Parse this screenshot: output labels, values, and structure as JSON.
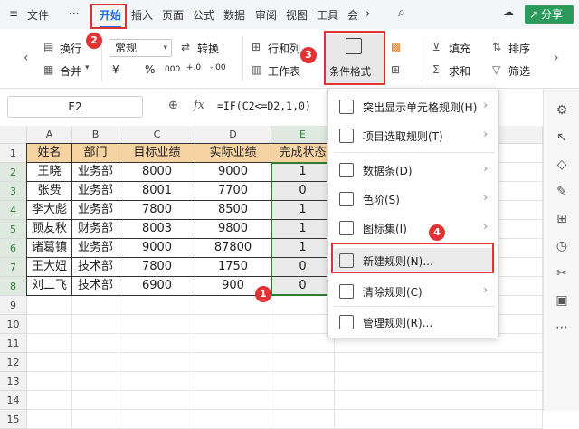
{
  "topbar": {
    "menu_icon": "≡",
    "file_label": "文件",
    "more_label": "···",
    "tabs": [
      "开始",
      "插入",
      "页面",
      "公式",
      "数据",
      "审阅",
      "视图",
      "工具",
      "会"
    ],
    "active_tab": "开始",
    "share_label": "分享"
  },
  "ribbon": {
    "wrap_label": "换行",
    "merge_label": "合并",
    "number_format": "常规",
    "convert_label": "转换",
    "currency_symbol": "¥",
    "percent_symbol": "%",
    "thousands_symbol": "000",
    "inc_decimal": "+.0",
    "dec_decimal": "-.00",
    "rowcol_label": "行和列",
    "sheet_label": "工作表",
    "cond_format_label": "条件格式",
    "fill_label": "填充",
    "sort_label": "排序",
    "sum_label": "求和",
    "filter_label": "筛选"
  },
  "formula_bar": {
    "cell_ref": "E2",
    "fx": "fx",
    "formula": "=IF(C2<=D2,1,0)"
  },
  "grid": {
    "columns": [
      "A",
      "B",
      "C",
      "D",
      "E"
    ],
    "rows": [
      "1",
      "2",
      "3",
      "4",
      "5",
      "6",
      "7",
      "8",
      "9",
      "10",
      "11",
      "12",
      "13",
      "14",
      "15"
    ],
    "header": [
      "姓名",
      "部门",
      "目标业绩",
      "实际业绩",
      "完成状态"
    ],
    "data": [
      [
        "王晓",
        "业务部",
        "8000",
        "9000",
        "1"
      ],
      [
        "张费",
        "业务部",
        "8001",
        "7700",
        "0"
      ],
      [
        "李大彪",
        "业务部",
        "7800",
        "8500",
        "1"
      ],
      [
        "顾友秋",
        "财务部",
        "8003",
        "9800",
        "1"
      ],
      [
        "诸葛镇",
        "业务部",
        "9000",
        "87800",
        "1"
      ],
      [
        "王大妞",
        "技术部",
        "7800",
        "1750",
        "0"
      ],
      [
        "刘二飞",
        "技术部",
        "6900",
        "900",
        "0"
      ]
    ]
  },
  "cond_menu": {
    "items": [
      {
        "label": "突出显示单元格规则(H)",
        "submenu": true
      },
      {
        "label": "项目选取规则(T)",
        "submenu": true
      },
      {
        "label": "数据条(D)",
        "submenu": true
      },
      {
        "label": "色阶(S)",
        "submenu": true
      },
      {
        "label": "图标集(I)",
        "submenu": true
      },
      {
        "label": "新建规则(N)...",
        "submenu": false
      },
      {
        "label": "清除规则(C)",
        "submenu": true
      },
      {
        "label": "管理规则(R)...",
        "submenu": false
      }
    ],
    "arrow": "›"
  },
  "annotations": {
    "badges": [
      "1",
      "2",
      "3",
      "4"
    ],
    "color": "#e03333"
  },
  "colors": {
    "accent": "#1f6feb",
    "header_fill": "#f5d3a3",
    "selection_green": "#2e7d32",
    "share_green": "#2c9a5c"
  }
}
